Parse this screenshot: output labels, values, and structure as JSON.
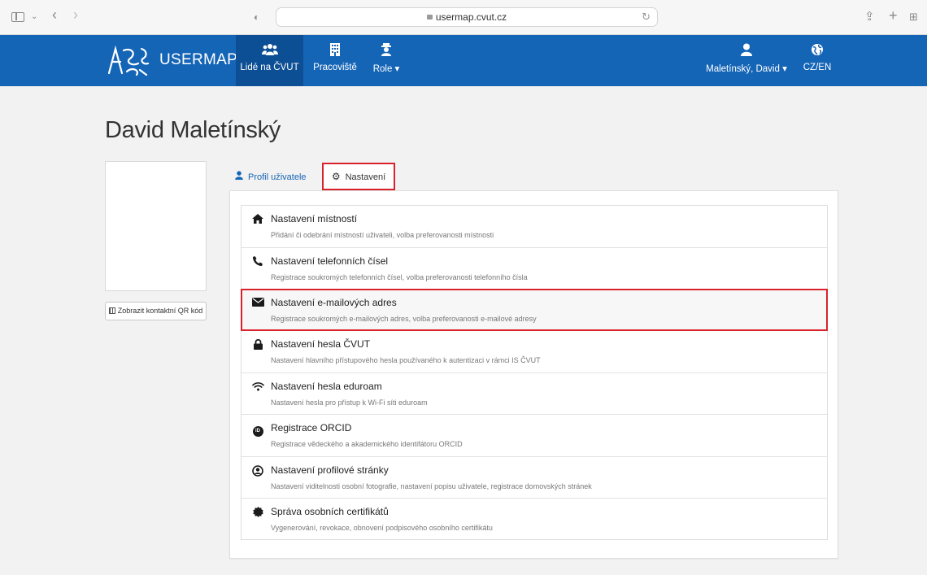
{
  "browser": {
    "url": "usermap.cvut.cz"
  },
  "nav": {
    "brand": "USERMAP",
    "items": [
      {
        "label": "Lidé na ČVUT",
        "icon": "users-icon"
      },
      {
        "label": "Pracoviště",
        "icon": "building-icon"
      },
      {
        "label": "Role ▾",
        "icon": "role-icon"
      }
    ],
    "user": {
      "label": "Maletínský, David ▾",
      "icon": "user-icon"
    },
    "lang": {
      "label": "CZ/EN",
      "icon": "globe-icon"
    }
  },
  "page": {
    "title": "David Maletínský",
    "qr_button": "Zobrazit kontaktní QR kód",
    "tabs": [
      {
        "label": "Profil uživatele",
        "icon": "user-icon"
      },
      {
        "label": "Nastavení",
        "icon": "gear-icon"
      }
    ]
  },
  "settings": [
    {
      "title": "Nastavení místností",
      "desc": "Přidání či odebrání místností uživateli, volba preferovanosti místnosti",
      "icon": "home-icon"
    },
    {
      "title": "Nastavení telefonních čísel",
      "desc": "Registrace soukromých telefonních čísel, volba preferovanosti telefonního čísla",
      "icon": "phone-icon"
    },
    {
      "title": "Nastavení e-mailových adres",
      "desc": "Registrace soukromých e-mailových adres, volba preferovanosti e-mailové adresy",
      "icon": "envelope-icon"
    },
    {
      "title": "Nastavení hesla ČVUT",
      "desc": "Nastavení hlavního přístupového hesla používaného k autentizaci v rámci IS ČVUT",
      "icon": "lock-icon"
    },
    {
      "title": "Nastavení hesla eduroam",
      "desc": "Nastavení hesla pro přístup k Wi-Fi síti eduroam",
      "icon": "wifi-icon"
    },
    {
      "title": "Registrace ORCID",
      "desc": "Registrace vědeckého a akademického identifátoru ORCID",
      "icon": "orcid-icon"
    },
    {
      "title": "Nastavení profilové stránky",
      "desc": "Nastavení viditelnosti osobní fotografie, nastavení popisu uživatele, registrace domovských stránek",
      "icon": "user-circle-icon"
    },
    {
      "title": "Správa osobních certifikátů",
      "desc": "Vygenerování, revokace, obnovení podpisového osobního certifikátu",
      "icon": "certificate-icon"
    }
  ],
  "colors": {
    "nav_bg": "#1565b7",
    "nav_active": "#0d4f94",
    "highlight": "#d9222b"
  }
}
